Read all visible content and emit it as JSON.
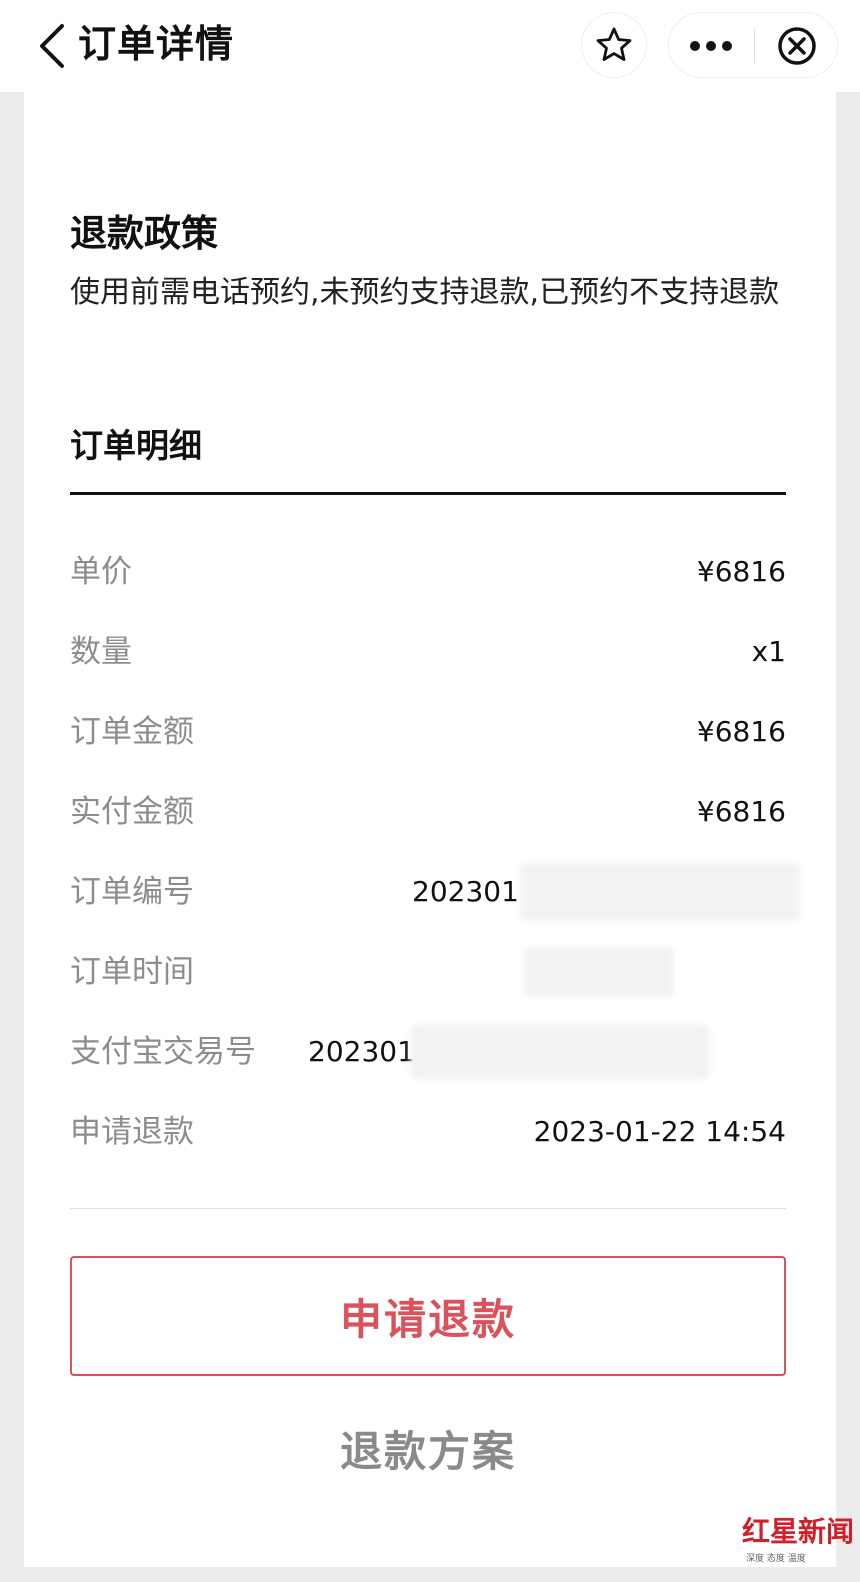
{
  "header": {
    "title": "订单详情",
    "icons": {
      "back": "chevron-left-icon",
      "star": "star-icon",
      "more": "more-icon",
      "close": "close-circle-icon"
    }
  },
  "policy": {
    "heading": "退款政策",
    "text": "使用前需电话预约,未预约支持退款,已预约不支持退款"
  },
  "detail": {
    "heading": "订单明细",
    "rows": [
      {
        "label": "单价",
        "value": "¥6816"
      },
      {
        "label": "数量",
        "value": "x1"
      },
      {
        "label": "订单金额",
        "value": "¥6816"
      },
      {
        "label": "实付金额",
        "value": "¥6816"
      },
      {
        "label": "订单编号",
        "value": "202301"
      },
      {
        "label": "订单时间",
        "value": ""
      },
      {
        "label": "支付宝交易号",
        "value": "202301"
      },
      {
        "label": "申请退款",
        "value": "2023-01-22 14:54"
      }
    ]
  },
  "actions": {
    "refund_button": "申请退款",
    "plan_link": "退款方案"
  },
  "watermark": {
    "main": "红星新闻",
    "sub": "深度 态度 温度"
  },
  "colors": {
    "accent": "#d9525c",
    "label_gray": "#8d8d8d",
    "page_bg": "#ececec",
    "watermark_red": "#d0202a"
  }
}
